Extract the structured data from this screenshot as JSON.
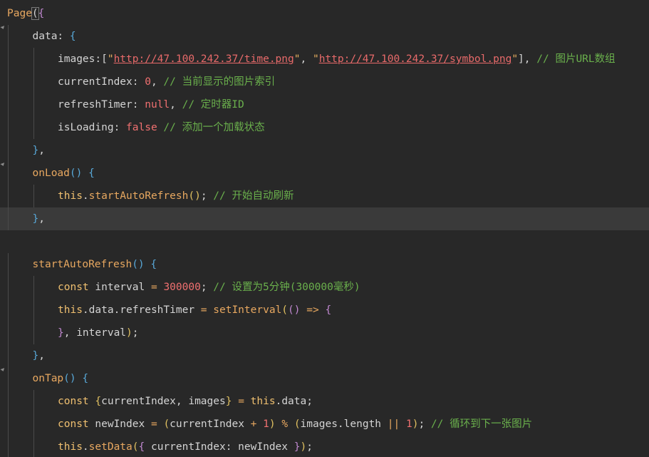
{
  "editor": {
    "language": "javascript",
    "current_line": 10,
    "lines": [
      {
        "indent": 0,
        "fold": false,
        "tokens": [
          [
            "fn",
            "Page"
          ],
          [
            "bm",
            "("
          ],
          [
            "br2",
            "{"
          ]
        ]
      },
      {
        "indent": 1,
        "fold": true,
        "tokens": [
          [
            "pr",
            "data: "
          ],
          [
            "br3",
            "{"
          ]
        ]
      },
      {
        "indent": 2,
        "fold": false,
        "tokens": [
          [
            "pr",
            "images:["
          ],
          [
            "qt",
            "\""
          ],
          [
            "st",
            "http://47.100.242.37/time.png"
          ],
          [
            "qt",
            "\""
          ],
          [
            "pr",
            ", "
          ],
          [
            "qt",
            "\""
          ],
          [
            "st",
            "http://47.100.242.37/symbol.png"
          ],
          [
            "qt",
            "\""
          ],
          [
            "pr",
            "], "
          ],
          [
            "co",
            "// 图片URL数组"
          ]
        ]
      },
      {
        "indent": 2,
        "fold": false,
        "tokens": [
          [
            "pr",
            "currentIndex: "
          ],
          [
            "nu",
            "0"
          ],
          [
            "pr",
            ", "
          ],
          [
            "co",
            "// 当前显示的图片索引"
          ]
        ]
      },
      {
        "indent": 2,
        "fold": false,
        "tokens": [
          [
            "pr",
            "refreshTimer: "
          ],
          [
            "nu",
            "null"
          ],
          [
            "pr",
            ", "
          ],
          [
            "co",
            "// 定时器ID"
          ]
        ]
      },
      {
        "indent": 2,
        "fold": false,
        "tokens": [
          [
            "pr",
            "isLoading: "
          ],
          [
            "nu",
            "false"
          ],
          [
            "pr",
            " "
          ],
          [
            "co",
            "// 添加一个加载状态"
          ]
        ]
      },
      {
        "indent": 1,
        "fold": false,
        "tokens": [
          [
            "br3",
            "}"
          ],
          [
            "pr",
            ","
          ]
        ]
      },
      {
        "indent": 1,
        "fold": true,
        "tokens": [
          [
            "fn",
            "onLoad"
          ],
          [
            "br3",
            "()"
          ],
          [
            "pr",
            " "
          ],
          [
            "br3",
            "{"
          ]
        ]
      },
      {
        "indent": 2,
        "fold": false,
        "tokens": [
          [
            "kw",
            "this"
          ],
          [
            "pr",
            "."
          ],
          [
            "fn",
            "startAutoRefresh"
          ],
          [
            "lg",
            "()"
          ],
          [
            "pr",
            "; "
          ],
          [
            "co",
            "// 开始自动刷新"
          ]
        ]
      },
      {
        "indent": 1,
        "fold": false,
        "tokens": [
          [
            "br3",
            "}"
          ],
          [
            "pr",
            ","
          ]
        ]
      },
      {
        "indent": 0,
        "fold": false,
        "tokens": []
      },
      {
        "indent": 1,
        "fold": false,
        "tokens": [
          [
            "fn",
            "startAutoRefresh"
          ],
          [
            "br3",
            "()"
          ],
          [
            "pr",
            " "
          ],
          [
            "br3",
            "{"
          ]
        ]
      },
      {
        "indent": 2,
        "fold": false,
        "tokens": [
          [
            "kw",
            "const"
          ],
          [
            "pr",
            " interval "
          ],
          [
            "op",
            "="
          ],
          [
            "pr",
            " "
          ],
          [
            "nu",
            "300000"
          ],
          [
            "pr",
            "; "
          ],
          [
            "co",
            "// 设置为5分钟(300000毫秒)"
          ]
        ]
      },
      {
        "indent": 2,
        "fold": false,
        "tokens": [
          [
            "kw",
            "this"
          ],
          [
            "pr",
            ".data.refreshTimer "
          ],
          [
            "op",
            "="
          ],
          [
            "pr",
            " "
          ],
          [
            "fn",
            "setInterval"
          ],
          [
            "lg",
            "("
          ],
          [
            "br2",
            "()"
          ],
          [
            "pr",
            " "
          ],
          [
            "op",
            "=>"
          ],
          [
            "pr",
            " "
          ],
          [
            "br2",
            "{"
          ]
        ]
      },
      {
        "indent": 2,
        "fold": false,
        "tokens": [
          [
            "br2",
            "}"
          ],
          [
            "pr",
            ", interval"
          ],
          [
            "lg",
            ")"
          ],
          [
            "pr",
            ";"
          ]
        ]
      },
      {
        "indent": 1,
        "fold": false,
        "tokens": [
          [
            "br3",
            "}"
          ],
          [
            "pr",
            ","
          ]
        ]
      },
      {
        "indent": 1,
        "fold": true,
        "tokens": [
          [
            "fn",
            "onTap"
          ],
          [
            "br3",
            "()"
          ],
          [
            "pr",
            " "
          ],
          [
            "br3",
            "{"
          ]
        ]
      },
      {
        "indent": 2,
        "fold": false,
        "tokens": [
          [
            "kw",
            "const"
          ],
          [
            "pr",
            " "
          ],
          [
            "lg",
            "{"
          ],
          [
            "pr",
            "currentIndex, images"
          ],
          [
            "lg",
            "}"
          ],
          [
            "pr",
            " "
          ],
          [
            "op",
            "="
          ],
          [
            "pr",
            " "
          ],
          [
            "kw",
            "this"
          ],
          [
            "pr",
            ".data;"
          ]
        ]
      },
      {
        "indent": 2,
        "fold": false,
        "tokens": [
          [
            "kw",
            "const"
          ],
          [
            "pr",
            " newIndex "
          ],
          [
            "op",
            "="
          ],
          [
            "pr",
            " "
          ],
          [
            "lg",
            "("
          ],
          [
            "pr",
            "currentIndex "
          ],
          [
            "op",
            "+"
          ],
          [
            "pr",
            " "
          ],
          [
            "nu",
            "1"
          ],
          [
            "lg",
            ")"
          ],
          [
            "pr",
            " "
          ],
          [
            "op",
            "%"
          ],
          [
            "pr",
            " "
          ],
          [
            "lg",
            "("
          ],
          [
            "pr",
            "images.length "
          ],
          [
            "op",
            "||"
          ],
          [
            "pr",
            " "
          ],
          [
            "nu",
            "1"
          ],
          [
            "lg",
            ")"
          ],
          [
            "pr",
            "; "
          ],
          [
            "co",
            "// 循环到下一张图片"
          ]
        ]
      },
      {
        "indent": 2,
        "fold": false,
        "tokens": [
          [
            "kw",
            "this"
          ],
          [
            "pr",
            "."
          ],
          [
            "fn",
            "setData"
          ],
          [
            "lg",
            "("
          ],
          [
            "br2",
            "{"
          ],
          [
            "pr",
            " currentIndex: newIndex "
          ],
          [
            "br2",
            "}"
          ],
          [
            "lg",
            ")"
          ],
          [
            "pr",
            ";"
          ]
        ]
      }
    ]
  }
}
